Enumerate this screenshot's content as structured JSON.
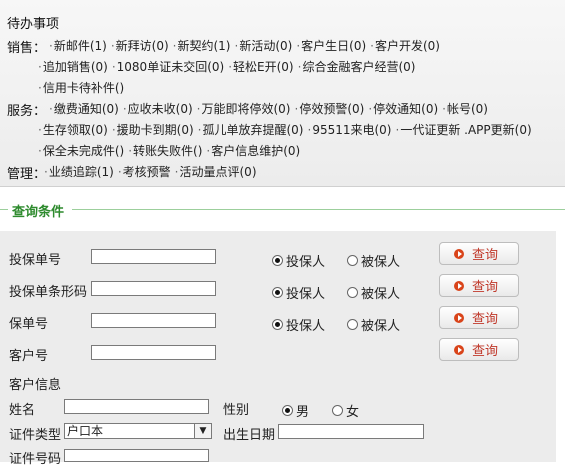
{
  "todo": {
    "title": "待办事项",
    "sales": {
      "label": "销售：",
      "line1": [
        "新邮件(1)",
        "新拜访(0)",
        "新契约(1)",
        "新活动(0)",
        "客户生日(0)",
        "客户开发(0)"
      ],
      "line2": [
        "追加销售(0)",
        "1080单证未交回(0)",
        "轻松E开(0)",
        "综合金融客户经营(0)"
      ],
      "line3": [
        "信用卡待补件()"
      ]
    },
    "service": {
      "label": "服务：",
      "line1": [
        "缴费通知(0)",
        "应收未收(0)",
        "万能即将停效(0)",
        "停效预警(0)",
        "停效通知(0)",
        "帐号(0)"
      ],
      "line2": [
        "生存领取(0)",
        "援助卡到期(0)",
        "孤儿单放弃提醒(0)",
        "95511来电(0)",
        "一代证更新 .APP更新(0)"
      ],
      "line3": [
        "保全未完成件()",
        "转账失败件()",
        "客户信息维护(0)"
      ]
    },
    "manage": {
      "label": "管理：",
      "line1": [
        "业绩追踪(1)",
        "考核预警",
        "活动量点评(0)"
      ]
    }
  },
  "query": {
    "section_title": "查询条件",
    "policy_no_label": "投保单号",
    "policy_barcode_label": "投保单条形码",
    "insurance_no_label": "保单号",
    "customer_no_label": "客户号",
    "customer_info_label": "客户信息",
    "applicant": "投保人",
    "insured": "被保人",
    "query_btn": "查询",
    "name_label": "姓名",
    "gender_label": "性别",
    "male": "男",
    "female": "女",
    "id_type_label": "证件类型",
    "id_type_value": "户口本",
    "birth_label": "出生日期",
    "id_no_label": "证件号码"
  }
}
